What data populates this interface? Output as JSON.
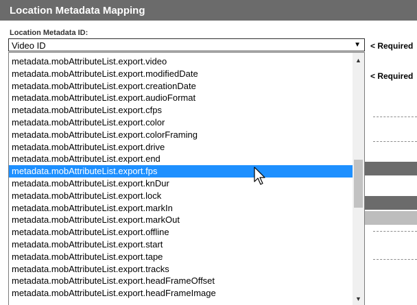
{
  "header": {
    "title": "Location Metadata Mapping"
  },
  "field": {
    "label": "Location Metadata ID:",
    "selected_value": "Video ID",
    "dropdown_arrow": "▼"
  },
  "required_marker_1": "< Required",
  "required_marker_2": "< Required",
  "options": [
    "metadata.mobAttributeList.export.video",
    "metadata.mobAttributeList.export.modifiedDate",
    "metadata.mobAttributeList.export.creationDate",
    "metadata.mobAttributeList.export.audioFormat",
    "metadata.mobAttributeList.export.cfps",
    "metadata.mobAttributeList.export.color",
    "metadata.mobAttributeList.export.colorFraming",
    "metadata.mobAttributeList.export.drive",
    "metadata.mobAttributeList.export.end",
    "metadata.mobAttributeList.export.fps",
    "metadata.mobAttributeList.export.knDur",
    "metadata.mobAttributeList.export.lock",
    "metadata.mobAttributeList.export.markIn",
    "metadata.mobAttributeList.export.markOut",
    "metadata.mobAttributeList.export.offline",
    "metadata.mobAttributeList.export.start",
    "metadata.mobAttributeList.export.tape",
    "metadata.mobAttributeList.export.tracks",
    "metadata.mobAttributeList.export.headFrameOffset",
    "metadata.mobAttributeList.export.headFrameImage"
  ],
  "highlighted_option": "metadata.mobAttributeList.export.fps",
  "scroll_up_arrow": "▲",
  "scroll_down_arrow": "▼",
  "icons": {
    "cursor": "mouse-pointer-icon"
  },
  "colors": {
    "header_bg": "#6b6b6b",
    "highlight": "#1e90ff"
  }
}
